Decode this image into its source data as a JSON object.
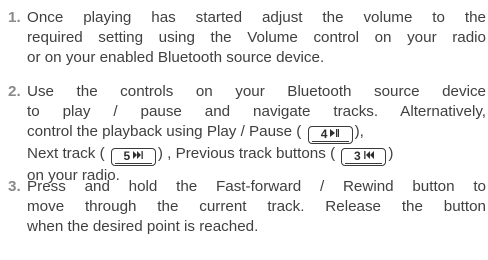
{
  "steps": [
    {
      "number": "1.",
      "lines": [
        "Once playing has started adjust the volume to the",
        "required setting using the Volume control on your radio",
        "or on your enabled Bluetooth source device."
      ]
    },
    {
      "number": "2.",
      "line1": "Use the controls on your Bluetooth source device",
      "line2": "to play / pause and navigate tracks. Alternatively,",
      "line3_pre": "control the playback using Play / Pause (",
      "line3_post": "),",
      "line4_pre": "Next track (",
      "line4_mid": ") , Previous track buttons (",
      "line4_post": ")",
      "line5": "on your radio."
    },
    {
      "number": "3.",
      "lines": [
        "Press and hold the Fast-forward / Rewind button to",
        "move through the current track. Release the button",
        "when the desired point is reached."
      ]
    }
  ],
  "buttons": {
    "play_pause": {
      "number": "4",
      "icon": "play-pause-icon"
    },
    "next_track": {
      "number": "5",
      "icon": "next-track-icon"
    },
    "previous_track": {
      "number": "3",
      "icon": "previous-track-icon"
    }
  },
  "colors": {
    "text": "#404040",
    "step_number": "#8a8a8a",
    "button_outline": "#3a3a3a"
  }
}
